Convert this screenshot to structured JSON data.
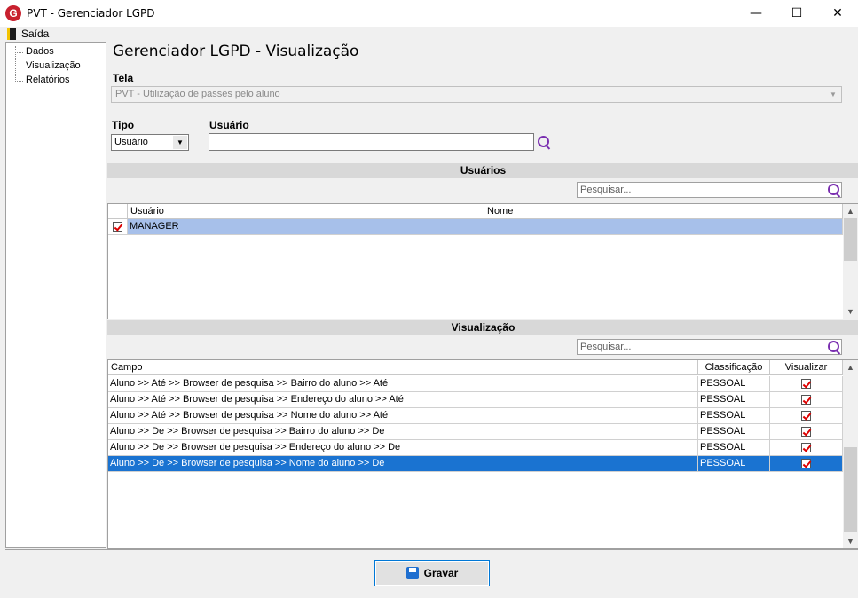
{
  "window": {
    "logo_letter": "G",
    "title": "PVT - Gerenciador LGPD",
    "minimize": "—",
    "maximize": "☐",
    "close": "✕"
  },
  "menu": {
    "exit_label": "Saída"
  },
  "tree": {
    "items": [
      "Dados",
      "Visualização",
      "Relatórios"
    ]
  },
  "page": {
    "title": "Gerenciador LGPD - Visualização"
  },
  "form": {
    "tela_label": "Tela",
    "tela_value": "PVT - Utilização de passes pelo aluno",
    "tipo_label": "Tipo",
    "tipo_value": "Usuário",
    "usuario_label": "Usuário",
    "usuario_value": ""
  },
  "usuarios": {
    "header": "Usuários",
    "search_placeholder": "Pesquisar...",
    "columns": [
      "Usuário",
      "Nome"
    ],
    "rows": [
      {
        "checked": true,
        "usuario": "MANAGER",
        "nome": ""
      }
    ]
  },
  "visualizacao": {
    "header": "Visualização",
    "search_placeholder": "Pesquisar...",
    "columns": [
      "Campo",
      "Classificação",
      "Visualizar"
    ],
    "rows": [
      {
        "campo": "Aluno >> Até >> Browser de pesquisa >> Bairro do aluno >> Até",
        "classificacao": "PESSOAL",
        "visualizar": true
      },
      {
        "campo": "Aluno >> Até >> Browser de pesquisa >> Endereço do aluno >> Até",
        "classificacao": "PESSOAL",
        "visualizar": true
      },
      {
        "campo": "Aluno >> Até >> Browser de pesquisa >> Nome do aluno >> Até",
        "classificacao": "PESSOAL",
        "visualizar": true
      },
      {
        "campo": "Aluno >> De >> Browser de pesquisa >> Bairro do aluno >> De",
        "classificacao": "PESSOAL",
        "visualizar": true
      },
      {
        "campo": "Aluno >> De >> Browser de pesquisa >> Endereço do aluno >> De",
        "classificacao": "PESSOAL",
        "visualizar": true
      },
      {
        "campo": "Aluno >> De >> Browser de pesquisa >> Nome do aluno >> De",
        "classificacao": "PESSOAL",
        "visualizar": true,
        "selected": true
      }
    ]
  },
  "footer": {
    "save_label": "Gravar"
  }
}
